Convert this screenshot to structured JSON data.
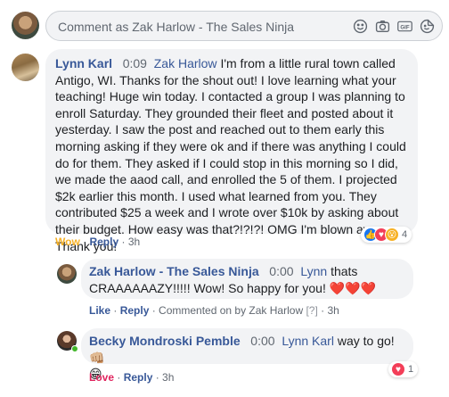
{
  "composer": {
    "placeholder": "Comment as Zak Harlow - The Sales Ninja",
    "icons": [
      "emoji-icon",
      "camera-icon",
      "gif-icon",
      "sticker-icon"
    ],
    "gif_label": "GIF"
  },
  "comments": [
    {
      "author": "Lynn Karl",
      "timestamp": "0:09",
      "mention": "Zak Harlow",
      "text_lines": [
        "I'm from a little rural town called",
        "Antigo, WI. Thanks for the shout out! I love learning what your",
        "teaching! Huge win today. I contacted a group I was planning to",
        "enroll Saturday. They grounded their fleet and posted about it",
        "yesterday. I saw the post and reached out to them early this",
        "morning asking if they were ok and if there was anything I could",
        "do for them. They asked if I could stop in this morning so I did,",
        "we made the aaod call, and enrolled the 5 of them. I projected",
        "$2k earlier this month. I used what learned from you. They",
        "contributed $25 a week and I wrote over $10k by asking about",
        "their budget. How easy was that?!?!?! OMG I'm blown away.",
        "Thank you!"
      ],
      "reaction_label": "Wow",
      "reply_label": "Reply",
      "age": "3h",
      "reaction_count": "4"
    },
    {
      "author": "Zak Harlow - The Sales Ninja",
      "timestamp": "0:00",
      "mention": "Lynn",
      "text_first": "thats",
      "text_second": "CRAAAAAAZY!!!!! Wow! So happy for you! ❤️❤️❤️",
      "like_label": "Like",
      "reply_label": "Reply",
      "commented_on_by": "Commented on by Zak Harlow",
      "help_marker": "[?]",
      "age": "3h"
    },
    {
      "author": "Becky Mondroski Pemble",
      "timestamp": "0:00",
      "mention": "Lynn Karl",
      "text_first": "way to go! 👊🏼",
      "text_second": "😁",
      "reaction_label": "Love",
      "reply_label": "Reply",
      "age": "3h",
      "reaction_count": "1"
    }
  ],
  "colors": {
    "link": "#385898",
    "bubble": "#f2f3f5",
    "wow": "#f7b125",
    "love": "#e0245e"
  }
}
